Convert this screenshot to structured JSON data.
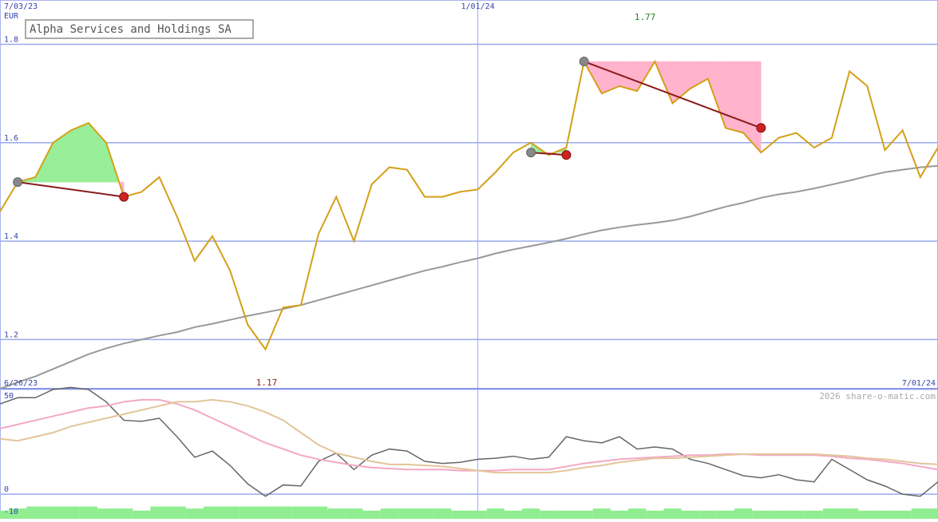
{
  "chart_data": [
    {
      "type": "line",
      "title": "Alpha Services and Holdings SA",
      "currency": "EUR",
      "ylim": [
        1.1,
        1.89
      ],
      "yticks": [
        1.2,
        1.4,
        1.6,
        1.8
      ],
      "ytick_labels": [
        "1.2",
        "1.4",
        "1.6",
        "1.8"
      ],
      "top_date_labels": [
        "7/03/23",
        "1/01/24"
      ],
      "bottom_date_labels": [
        "6/26/23",
        "7/01/24"
      ],
      "high_label": "1.77",
      "low_label": "1.17",
      "grid": true,
      "line_color": "#d4a017",
      "ma_color": "#999999",
      "x": [
        "6/26/23",
        "7/03/23",
        "7/10/23",
        "7/17/23",
        "7/24/23",
        "7/31/23",
        "8/07/23",
        "8/14/23",
        "8/21/23",
        "8/28/23",
        "9/04/23",
        "9/11/23",
        "9/18/23",
        "9/25/23",
        "10/02/23",
        "10/09/23",
        "10/16/23",
        "10/23/23",
        "10/30/23",
        "11/06/23",
        "11/13/23",
        "11/20/23",
        "11/27/23",
        "12/04/23",
        "12/11/23",
        "12/18/23",
        "12/25/23",
        "1/01/24",
        "1/08/24",
        "1/15/24",
        "1/22/24",
        "1/29/24",
        "2/05/24",
        "2/12/24",
        "2/19/24",
        "2/26/24",
        "3/04/24",
        "3/11/24",
        "3/18/24",
        "3/25/24",
        "4/01/24",
        "4/08/24",
        "4/15/24",
        "4/22/24",
        "4/29/24",
        "5/06/24",
        "5/13/24",
        "5/20/24",
        "5/27/24",
        "6/03/24",
        "6/10/24",
        "6/17/24",
        "6/24/24",
        "7/01/24"
      ],
      "series": [
        {
          "key": "price",
          "values": [
            1.46,
            1.52,
            1.53,
            1.6,
            1.625,
            1.64,
            1.6,
            1.49,
            1.5,
            1.53,
            1.45,
            1.36,
            1.41,
            1.34,
            1.23,
            1.18,
            1.265,
            1.27,
            1.415,
            1.49,
            1.4,
            1.515,
            1.55,
            1.545,
            1.49,
            1.49,
            1.5,
            1.505,
            1.54,
            1.58,
            1.6,
            1.575,
            1.59,
            1.765,
            1.7,
            1.715,
            1.705,
            1.765,
            1.68,
            1.71,
            1.73,
            1.63,
            1.62,
            1.58,
            1.61,
            1.62,
            1.59,
            1.61,
            1.745,
            1.715,
            1.585,
            1.625,
            1.53,
            1.59
          ]
        },
        {
          "key": "moving-average",
          "values": [
            1.1,
            1.113,
            1.125,
            1.14,
            1.155,
            1.17,
            1.182,
            1.192,
            1.2,
            1.208,
            1.215,
            1.225,
            1.232,
            1.24,
            1.248,
            1.255,
            1.262,
            1.27,
            1.28,
            1.29,
            1.3,
            1.31,
            1.32,
            1.33,
            1.34,
            1.348,
            1.357,
            1.365,
            1.375,
            1.383,
            1.39,
            1.397,
            1.405,
            1.414,
            1.422,
            1.428,
            1.433,
            1.437,
            1.442,
            1.45,
            1.46,
            1.47,
            1.478,
            1.488,
            1.495,
            1.5,
            1.507,
            1.515,
            1.523,
            1.532,
            1.54,
            1.545,
            1.55,
            1.553
          ]
        }
      ],
      "signals": [
        {
          "start_date": "7/03/23",
          "start": 1.52,
          "end_date": "8/14/23",
          "end": 1.49
        },
        {
          "start_date": "1/22/24",
          "start": 1.58,
          "end_date": "2/05/24",
          "end": 1.575
        },
        {
          "start_date": "2/12/24",
          "start": 1.765,
          "end_date": "4/22/24",
          "end": 1.63
        }
      ]
    },
    {
      "type": "line",
      "ylim": [
        -12,
        51
      ],
      "yticks": [
        50,
        0,
        -10
      ],
      "ytick_labels": [
        "50",
        "0",
        "-10"
      ],
      "credit": "2026 share-o-matic.com",
      "x": [
        "6/26/23",
        "7/03/23",
        "7/10/23",
        "7/17/23",
        "7/24/23",
        "7/31/23",
        "8/07/23",
        "8/14/23",
        "8/21/23",
        "8/28/23",
        "9/04/23",
        "9/11/23",
        "9/18/23",
        "9/25/23",
        "10/02/23",
        "10/09/23",
        "10/16/23",
        "10/23/23",
        "10/30/23",
        "11/06/23",
        "11/13/23",
        "11/20/23",
        "11/27/23",
        "12/04/23",
        "12/11/23",
        "12/18/23",
        "12/25/23",
        "1/01/24",
        "1/08/24",
        "1/15/24",
        "1/22/24",
        "1/29/24",
        "2/05/24",
        "2/12/24",
        "2/19/24",
        "2/26/24",
        "3/04/24",
        "3/11/24",
        "3/18/24",
        "3/25/24",
        "4/01/24",
        "4/08/24",
        "4/15/24",
        "4/22/24",
        "4/29/24",
        "5/06/24",
        "5/13/24",
        "5/20/24",
        "5/27/24",
        "6/03/24",
        "6/10/24",
        "6/17/24",
        "6/24/24",
        "7/01/24"
      ],
      "series": [
        {
          "key": "oscillator",
          "color": "#666666",
          "values": [
            44,
            47,
            47,
            51,
            52,
            51,
            45,
            36,
            35.5,
            37,
            28,
            18,
            21,
            14,
            5,
            -1,
            4.5,
            4,
            16,
            20,
            12,
            19,
            22,
            21,
            16,
            15,
            15.5,
            17,
            17.5,
            18.5,
            17,
            18,
            28,
            26,
            25,
            28,
            22,
            23,
            22,
            17,
            15,
            12,
            9,
            8,
            9.5,
            7,
            6,
            17,
            12,
            7,
            4,
            0,
            -1,
            6
          ]
        },
        {
          "key": "signal-line-pink",
          "color": "#f4a8c4",
          "values": [
            32,
            34,
            36,
            38,
            40,
            42,
            43,
            45,
            46,
            46,
            44,
            41,
            37,
            33,
            29,
            25,
            22,
            19,
            17,
            15.5,
            14,
            13,
            12.5,
            12,
            12,
            12,
            11.5,
            11.5,
            11.5,
            12,
            12,
            12,
            13.5,
            15,
            16,
            17,
            17.5,
            18,
            18.5,
            19,
            19,
            19.5,
            19.5,
            19,
            19,
            19,
            19,
            18.5,
            17.5,
            17,
            16,
            15,
            13.5,
            12
          ]
        },
        {
          "key": "signal-line-tan",
          "color": "#e3c59a",
          "values": [
            27,
            26,
            28,
            30,
            33,
            35,
            37,
            39,
            41,
            43,
            45,
            45,
            46,
            45,
            43,
            40,
            36,
            30,
            24,
            20,
            18,
            16,
            14.5,
            14.5,
            14,
            13.5,
            12.5,
            11.5,
            10.5,
            10.5,
            10.5,
            10.5,
            11.5,
            13,
            14,
            15.5,
            16.5,
            17.5,
            17.5,
            18,
            18.5,
            19,
            19.5,
            19.5,
            19.5,
            19.5,
            19.5,
            19,
            18.5,
            17.5,
            17,
            16,
            15,
            14.5
          ]
        },
        {
          "key": "histogram",
          "color": "#90ee90",
          "values": [
            1,
            2,
            3,
            3,
            3,
            3,
            2,
            2,
            1,
            3,
            3,
            2,
            3,
            3,
            3,
            3,
            3,
            3,
            3,
            2,
            2,
            1,
            2,
            2,
            2,
            2,
            1,
            1,
            2,
            1,
            2,
            1,
            1,
            1,
            2,
            1,
            2,
            1,
            2,
            1,
            1,
            1,
            2,
            1,
            1,
            1,
            1,
            2,
            2,
            1,
            1,
            1,
            2,
            2
          ]
        }
      ]
    }
  ]
}
